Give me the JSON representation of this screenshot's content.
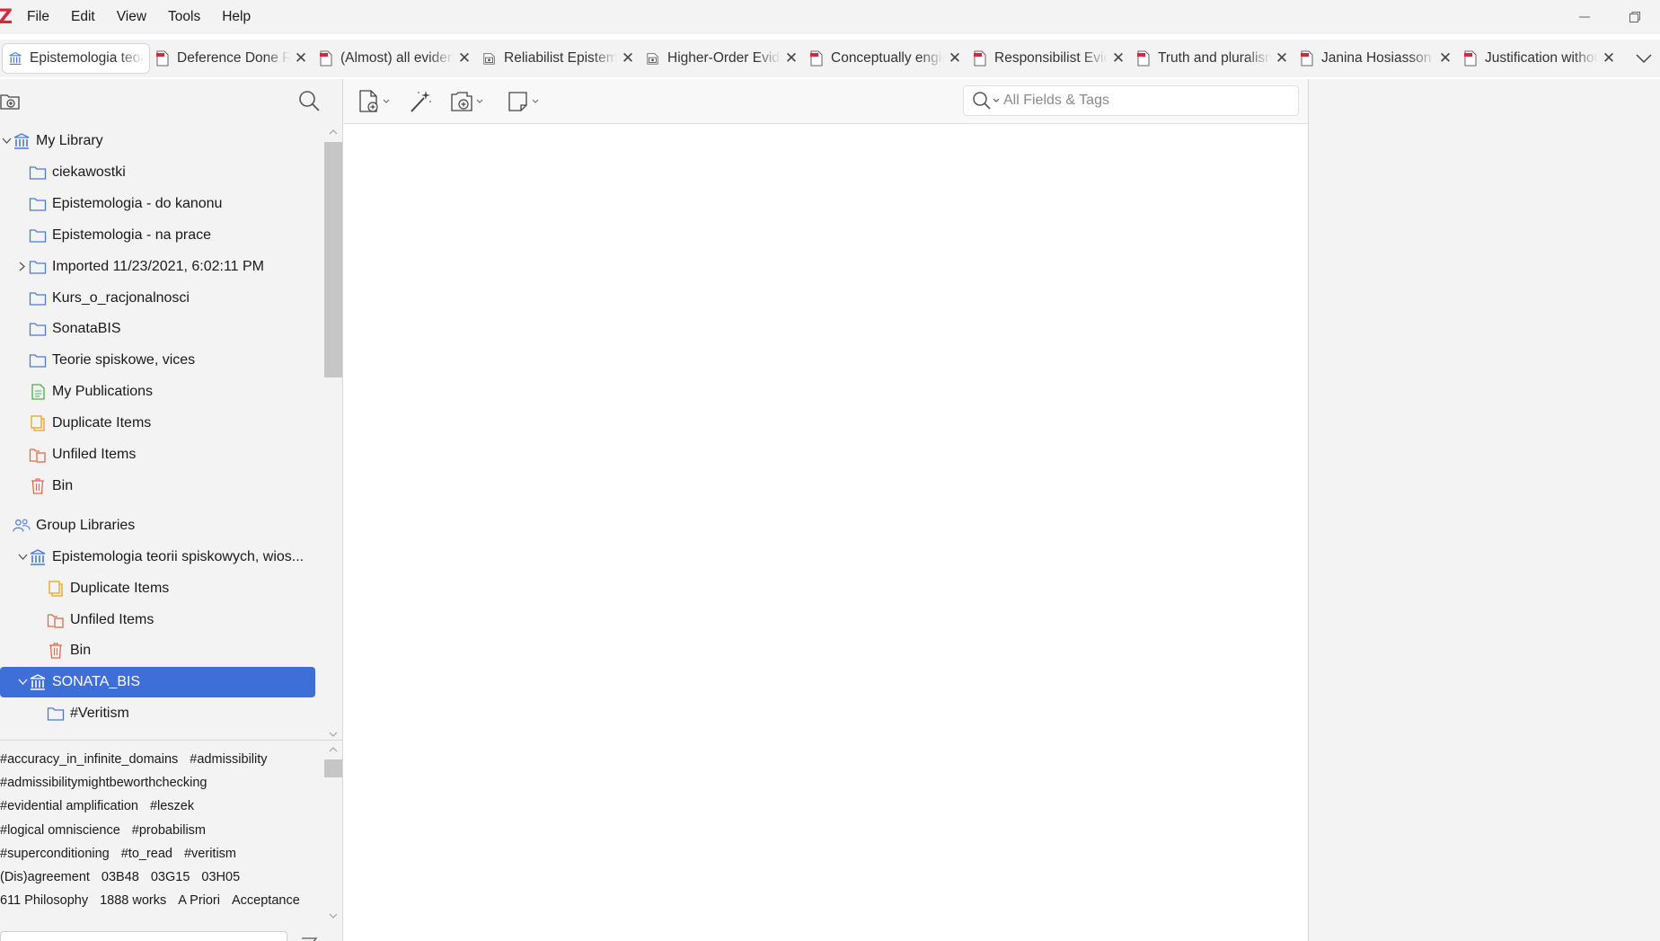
{
  "menu": {
    "logo": "Z",
    "items": [
      "File",
      "Edit",
      "View",
      "Tools",
      "Help"
    ]
  },
  "window_controls": {
    "minimize": "—",
    "restore": "❐"
  },
  "tabs": [
    {
      "label": "Epistemologia teorii spiskowych",
      "icon": "library-icon",
      "active": true
    },
    {
      "label": "Deference Done Right",
      "icon": "pdf-icon"
    },
    {
      "label": "(Almost) all evidence",
      "icon": "pdf-icon"
    },
    {
      "label": "Reliabilist Epistemology",
      "icon": "snapshot-icon"
    },
    {
      "label": "Higher-Order Evidence",
      "icon": "snapshot-icon"
    },
    {
      "label": "Conceptually engineering",
      "icon": "pdf-icon"
    },
    {
      "label": "Responsibilist Evidentialism",
      "icon": "pdf-icon"
    },
    {
      "label": "Truth and pluralism",
      "icon": "pdf-icon"
    },
    {
      "label": "Janina Hosiasson",
      "icon": "pdf-icon"
    },
    {
      "label": "Justification without",
      "icon": "pdf-icon"
    }
  ],
  "collections": {
    "my_library": "My Library",
    "items": [
      {
        "label": "ciekawostki",
        "icon": "folder-icon"
      },
      {
        "label": "Epistemologia - do kanonu",
        "icon": "folder-icon"
      },
      {
        "label": "Epistemologia - na prace",
        "icon": "folder-icon"
      },
      {
        "label": "Imported 11/23/2021, 6:02:11 PM",
        "icon": "folder-icon",
        "collapsed": true
      },
      {
        "label": "Kurs_o_racjonalnosci",
        "icon": "folder-icon"
      },
      {
        "label": "SonataBIS",
        "icon": "folder-icon"
      },
      {
        "label": "Teorie spiskowe, vices",
        "icon": "folder-icon"
      },
      {
        "label": "My Publications",
        "icon": "publications-icon"
      },
      {
        "label": "Duplicate Items",
        "icon": "duplicate-icon"
      },
      {
        "label": "Unfiled Items",
        "icon": "unfiled-icon"
      },
      {
        "label": "Bin",
        "icon": "bin-icon"
      }
    ],
    "group_libraries": "Group Libraries",
    "group1": {
      "label": "Epistemologia teorii spiskowych, wios...",
      "children": [
        "Duplicate Items",
        "Unfiled Items",
        "Bin"
      ]
    },
    "group2": {
      "label": "SONATA_BIS",
      "children": [
        "#Veritism"
      ]
    }
  },
  "tags": [
    [
      "#accuracy_in_infinite_domains",
      "#admissibility"
    ],
    [
      "#admissibilitymightbeworthchecking"
    ],
    [
      "#evidential amplification",
      "#leszek"
    ],
    [
      "#logical omniscience",
      "#probabilism"
    ],
    [
      "#superconditioning",
      "#to_read",
      "#veritism"
    ],
    [
      "(Dis)agreement",
      "03B48",
      "03G15",
      "03H05"
    ],
    [
      "611 Philosophy",
      "1888 works",
      "A Priori",
      "Acceptance"
    ]
  ],
  "search": {
    "placeholder": "All Fields & Tags",
    "value": ""
  },
  "colors": {
    "selection": "#3e6fd8",
    "folder": "#4a7ad8",
    "library": "#4a7ad8",
    "publications": "#4caf50",
    "duplicate": "#f0a020",
    "unfiled": "#e06a4a",
    "bin": "#e06a4a",
    "pdf": "#d4283b",
    "logo": "#d4283b"
  }
}
